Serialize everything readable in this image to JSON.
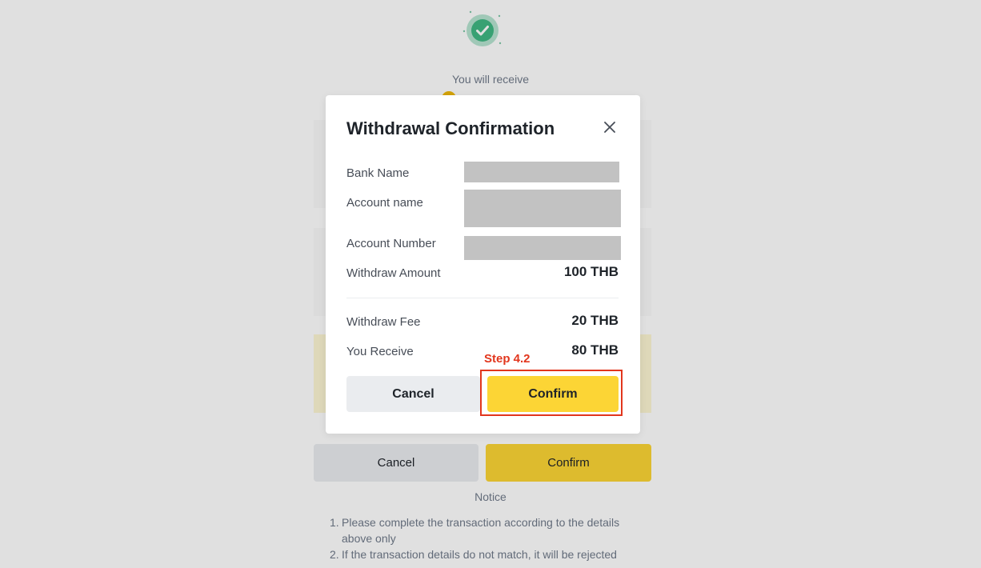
{
  "background": {
    "receive_label": "You will receive",
    "cancel_label": "Cancel",
    "confirm_label": "Confirm",
    "notice_title": "Notice",
    "notice_items": [
      {
        "num": "1.",
        "text": "Please complete the transaction according to the details above only"
      },
      {
        "num": "2.",
        "text": "If the transaction details do not match, it will be rejected"
      }
    ]
  },
  "modal": {
    "title": "Withdrawal Confirmation",
    "rows": {
      "bank_name": {
        "label": "Bank Name"
      },
      "account_name": {
        "label": "Account name"
      },
      "account_number": {
        "label": "Account Number"
      },
      "withdraw_amount": {
        "label": "Withdraw Amount",
        "value": "100 THB"
      },
      "withdraw_fee": {
        "label": "Withdraw Fee",
        "value": "20 THB"
      },
      "you_receive": {
        "label": "You Receive",
        "value": "80 THB"
      }
    },
    "step_label": "Step 4.2",
    "cancel_label": "Cancel",
    "confirm_label": "Confirm"
  },
  "icons": {
    "success": "check-circle-icon",
    "close": "close-icon"
  },
  "colors": {
    "accent_yellow": "#fcd535",
    "success_green": "#52b788",
    "annotation_red": "#e2361d",
    "redaction_gray": "#c2c2c2"
  }
}
